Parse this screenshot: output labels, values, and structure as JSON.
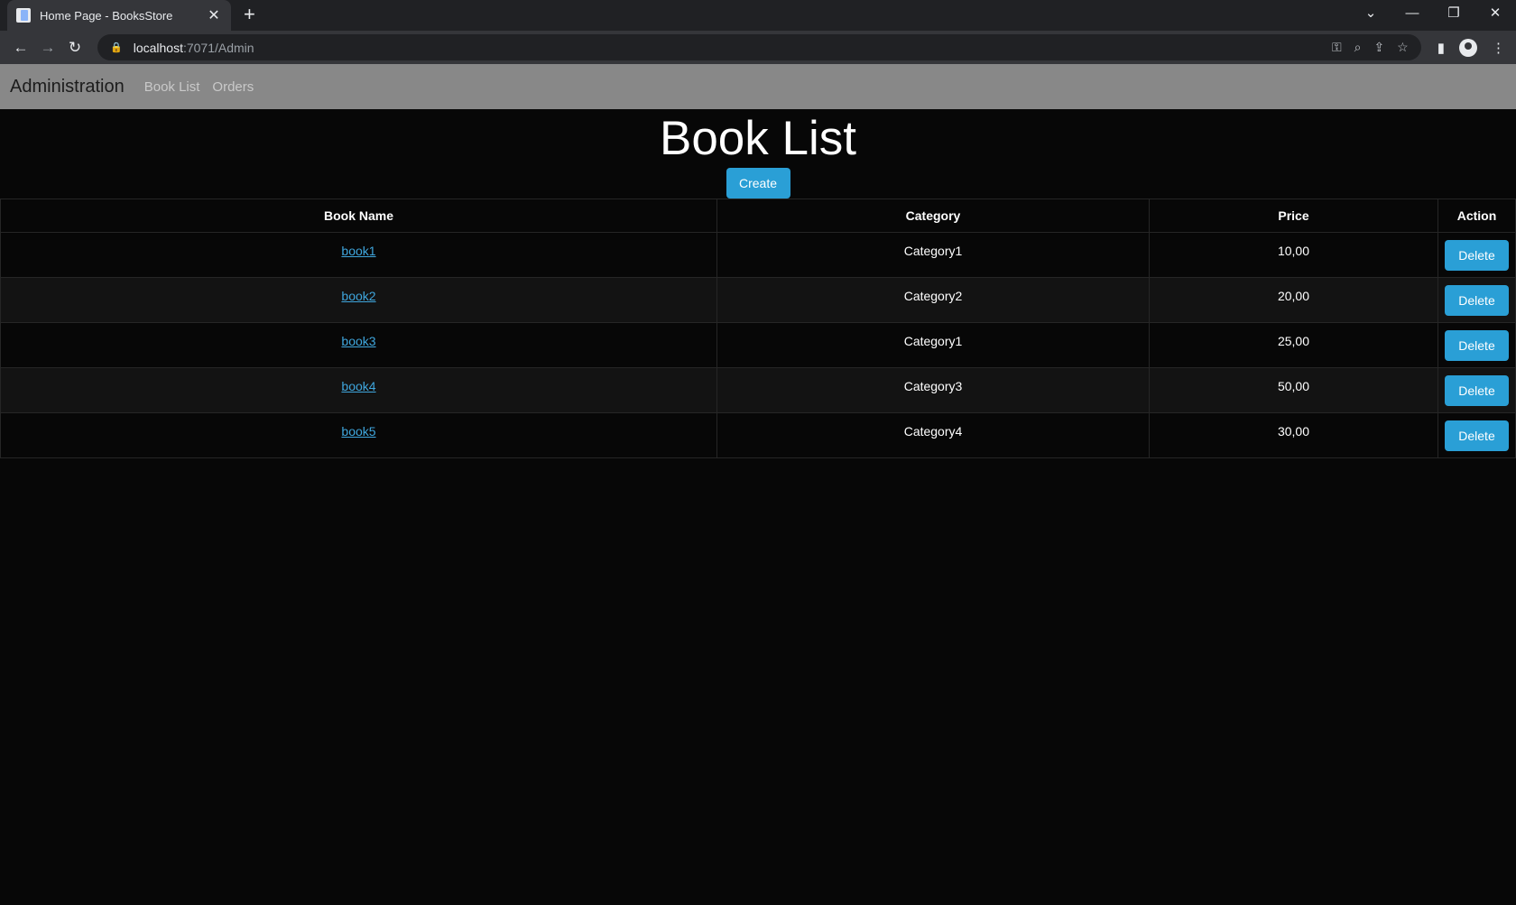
{
  "browser": {
    "tab_title": "Home Page - BooksStore",
    "url_host": "localhost",
    "url_path": ":7071/Admin"
  },
  "navbar": {
    "brand": "Administration",
    "links": [
      "Book List",
      "Orders"
    ]
  },
  "page": {
    "title": "Book List",
    "create_label": "Create"
  },
  "table": {
    "headers": [
      "Book Name",
      "Category",
      "Price",
      "Action"
    ],
    "rows": [
      {
        "name": "book1",
        "category": "Category1",
        "price": "10,00",
        "action": "Delete"
      },
      {
        "name": "book2",
        "category": "Category2",
        "price": "20,00",
        "action": "Delete"
      },
      {
        "name": "book3",
        "category": "Category1",
        "price": "25,00",
        "action": "Delete"
      },
      {
        "name": "book4",
        "category": "Category3",
        "price": "50,00",
        "action": "Delete"
      },
      {
        "name": "book5",
        "category": "Category4",
        "price": "30,00",
        "action": "Delete"
      }
    ]
  },
  "colors": {
    "accent": "#2a9fd6",
    "navbar_bg": "#888888",
    "page_bg": "#070707"
  }
}
